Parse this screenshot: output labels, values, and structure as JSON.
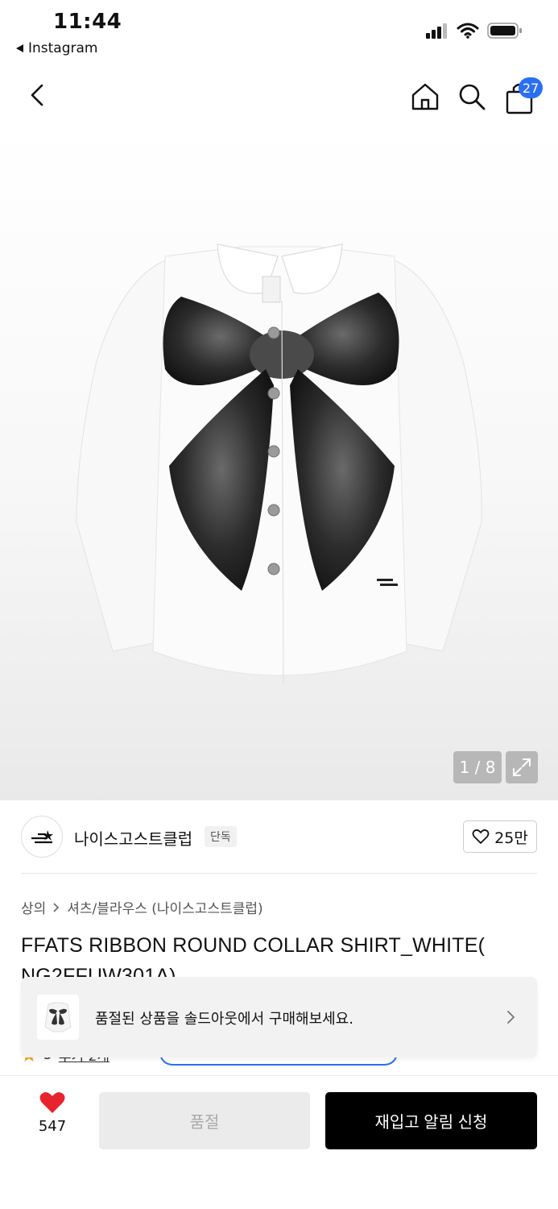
{
  "status_bar": {
    "time": "11:44",
    "back_app": "Instagram",
    "icons": [
      "signal-icon",
      "wifi-icon",
      "battery-icon"
    ]
  },
  "nav": {
    "icons": [
      "back-arrow-icon",
      "home-icon",
      "search-icon",
      "shopping-bag-icon"
    ],
    "cart_count": "27"
  },
  "gallery": {
    "page_indicator": "1 / 8",
    "expand_icon": "expand-icon"
  },
  "brand": {
    "name": "나이스고스트클럽",
    "tag": "단독",
    "likes": "25만"
  },
  "breadcrumb": {
    "category": "상의",
    "subcategory": "셔츠/블라우스 (나이스고스트클럽)"
  },
  "product": {
    "title": "FFATS RIBBON ROUND COLLAR SHIRT_WHITE( NG2FFUW301A)"
  },
  "banner": {
    "text": "품절된 상품을 솔드아웃에서 구매해보세요."
  },
  "rating": {
    "score": "5",
    "reviews": "후기 2개"
  },
  "bottom_bar": {
    "wish_count": "547",
    "soldout_label": "품절",
    "restock_label": "재입고 알림 신청"
  },
  "colors": {
    "accent": "#2a6ff2",
    "heart": "#e8232d",
    "primary_button": "#000000"
  }
}
